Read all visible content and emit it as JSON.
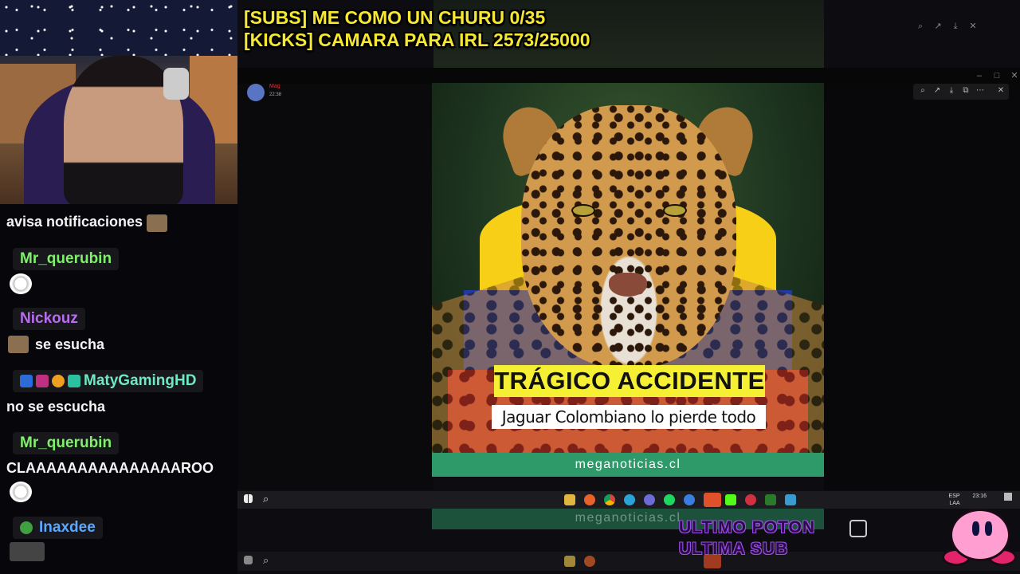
{
  "overlay": {
    "line1": "[SUBS] ME COMO UN CHURU 0/35",
    "line2": "[KICKS] CAMARA PARA IRL 2573/25000"
  },
  "chat": {
    "messages": [
      {
        "user": "",
        "text": "avisa notificaciones",
        "emote": "cat-emote"
      },
      {
        "user": "Mr_querubin",
        "user_color": "#7ef06a",
        "text": "",
        "emote": "face-emote"
      },
      {
        "user": "Nickouz",
        "user_color": "#b86cf0",
        "text": "se esucha",
        "emote": "cat-emote"
      },
      {
        "user": "MatyGamingHD",
        "user_color": "#6ee9c4",
        "text": "no se escucha"
      },
      {
        "user": "Mr_querubin",
        "user_color": "#7ef06a",
        "text": "CLAAAAAAAAAAAAAAAROO",
        "emote": "face-emote"
      },
      {
        "user": "Inaxdee",
        "user_color": "#5aa8ff",
        "text": ""
      }
    ]
  },
  "post": {
    "user": "Mag",
    "time": "22:38"
  },
  "image": {
    "headline": "TRÁGICO ACCIDENTE",
    "subhead": "Jaguar Colombiano lo pierde todo",
    "source": "meganoticias.cl",
    "colors": {
      "headline_bg": "#f6f034",
      "source_bg": "#2e9a6a",
      "flag_yellow": "#f6cf16",
      "flag_blue": "#1d3aa6",
      "flag_red": "#d2222b"
    }
  },
  "taskbar": {
    "lang": "ESP",
    "lang2": "LAA",
    "clock": "23:16"
  },
  "goal": {
    "line1": "ULTIMO POTON",
    "line2": "ULTIMA SUB"
  }
}
